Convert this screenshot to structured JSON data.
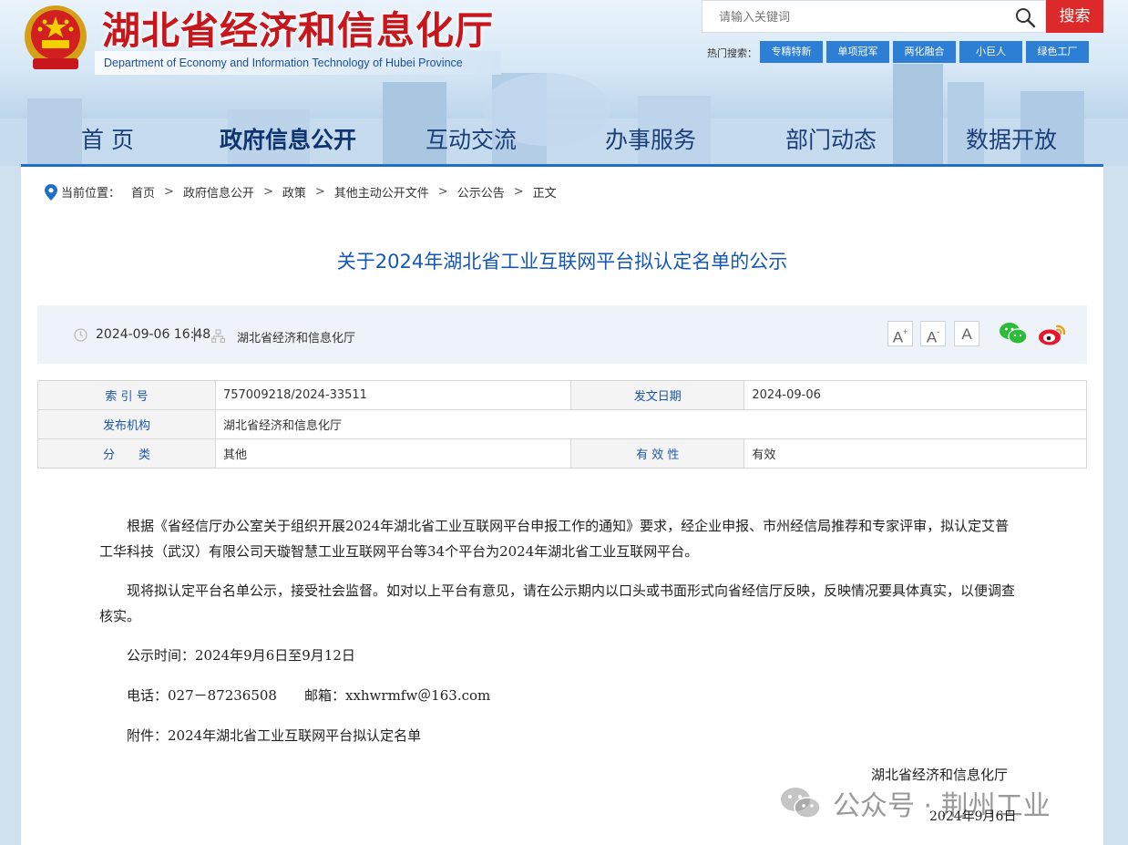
{
  "header": {
    "site_title": "湖北省经济和信息化厅",
    "site_subtitle": "Department of Economy and Information Technology of Hubei Province",
    "search_placeholder": "请输入关键词",
    "search_button": "搜索",
    "hot_label": "热门搜索：",
    "hot_tags": [
      "专精特新",
      "单项冠军",
      "两化融合",
      "小巨人",
      "绿色工厂"
    ]
  },
  "nav": {
    "items": [
      "首 页",
      "政府信息公开",
      "互动交流",
      "办事服务",
      "部门动态",
      "数据开放"
    ],
    "active": "政府信息公开"
  },
  "breadcrumb": {
    "label": "当前位置：",
    "items": [
      "首页",
      "政府信息公开",
      "政策",
      "其他主动公开文件",
      "公示公告",
      "正文"
    ],
    "separator": ">"
  },
  "article": {
    "title": "关于2024年湖北省工业互联网平台拟认定名单的公示",
    "datetime": "2024-09-06 16:48",
    "divider": "|",
    "source": "湖北省经济和信息化厅",
    "font_buttons": [
      "A",
      "A",
      "A"
    ],
    "font_button_marks": [
      "+",
      "-",
      ""
    ]
  },
  "info_table": {
    "index_label": "索 引 号",
    "index_value": "757009218/2024-33511",
    "date_label": "发文日期",
    "date_value": "2024-09-06",
    "publisher_label": "发布机构",
    "publisher_value": "湖北省经济和信息化厅",
    "category_label": "分　　类",
    "category_value": "其他",
    "validity_label": "有 效 性",
    "validity_value": "有效"
  },
  "body": {
    "p1": "根据《省经信厅办公室关于组织开展2024年湖北省工业互联网平台申报工作的通知》要求，经企业申报、市州经信局推荐和专家评审，拟认定艾普工华科技（武汉）有限公司天璇智慧工业互联网平台等34个平台为2024年湖北省工业互联网平台。",
    "p2": "现将拟认定平台名单公示，接受社会监督。如对以上平台有意见，请在公示期内以口头或书面形式向省经信厅反映，反映情况要具体真实，以便调查核实。",
    "p3": "公示时间：2024年9月6日至9月12日",
    "p4": "电话：027－87236508　　邮箱：xxhwrmfw＠163.com",
    "p5": "附件：2024年湖北省工业互联网平台拟认定名单",
    "sign_org": "湖北省经济和信息化厅",
    "sign_date": "2024年9月6日"
  },
  "watermark": {
    "text": "公众号 · 荆州工业"
  },
  "colors": {
    "brand_red": "#c8161d",
    "nav_text": "#1a3f7a",
    "title_blue": "#1557b4",
    "tag_blue": "#2d7ed5",
    "search_red": "#dc2a2a"
  }
}
